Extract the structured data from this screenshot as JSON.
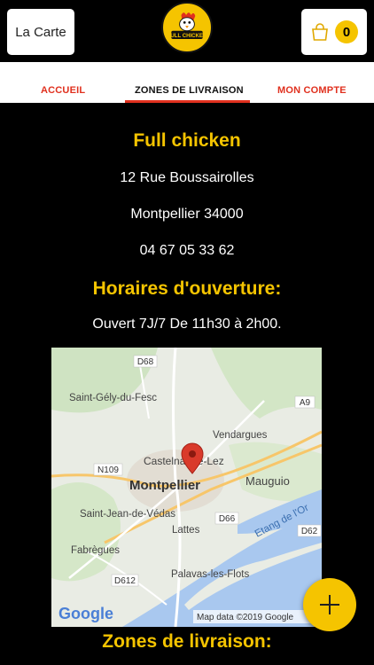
{
  "header": {
    "carte_label": "La Carte",
    "logo_text": "FULL CHICKEN",
    "cart_count": "0"
  },
  "nav": {
    "items": [
      "ACCUEIL",
      "ZONES DE LIVRAISON",
      "MON COMPTE"
    ],
    "active_index": 1
  },
  "restaurant": {
    "name": "Full chicken",
    "address": "12 Rue Boussairolles",
    "city": "Montpellier 34000",
    "phone": "04 67 05 33 62",
    "hours_title": "Horaires d'ouverture:",
    "hours": "Ouvert 7J/7 De 11h30 à 2h00.",
    "zones_title": "Zones de livraison:"
  },
  "map": {
    "labels": {
      "d68": "D68",
      "saint_gely": "Saint-Gély-du-Fesc",
      "a9": "A9",
      "vendargues": "Vendargues",
      "castelnau": "Castelnau-le-Lez",
      "n109": "N109",
      "montpellier": "Montpellier",
      "mauguio": "Mauguio",
      "saint_jean": "Saint-Jean-de-Védas",
      "d66": "D66",
      "etang": "Etang de l'Or",
      "lattes": "Lattes",
      "d62": "D62",
      "fabregues": "Fabrègues",
      "palavas": "Palavas-les-Flots",
      "d612": "D612",
      "google": "Google",
      "mapdata": "Map data ©2019 Google"
    }
  },
  "colors": {
    "accent_yellow": "#f5c400",
    "accent_red": "#e0301e",
    "background": "#000000"
  },
  "icons": {
    "cart": "shopping-bag-icon",
    "fab": "plus-icon",
    "pin": "map-pin-icon"
  }
}
